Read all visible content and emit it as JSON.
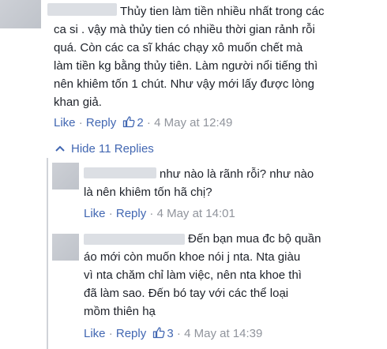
{
  "comment1": {
    "text_lines": [
      "Thủy tien làm tiền nhiều nhất trong các",
      "ca si . vậy mà thủy tien có nhiều thời gian rảnh rỗi",
      "quá. Còn các ca sĩ khác chạy xô muốn chết mà",
      "làm tiền kg bằng thủy tiên. Làm người nổi tiếng thì",
      "nên khiêm tốn 1 chút. Như vậy mới lấy được lòng",
      "khan giả."
    ],
    "like_label": "Like",
    "reply_label": "Reply",
    "like_count": "2",
    "timestamp": "4 May at 12:49"
  },
  "hide_replies_label": "Hide 11 Replies",
  "reply1": {
    "text_lines": [
      "như nào là rãnh rỗi? như nào",
      "là nên khiêm tốn hã chị?"
    ],
    "like_label": "Like",
    "reply_label": "Reply",
    "timestamp": "4 May at 14:01"
  },
  "reply2": {
    "text_lines": [
      "Đến bạn mua đc bộ quần",
      "áo mới còn muốn khoe nói j nta. Nta giàu",
      "vì nta chăm chỉ làm việc, nên nta khoe thì",
      "đã làm sao. Đến bó tay với các thể loại",
      "mồm thiên hạ"
    ],
    "like_label": "Like",
    "reply_label": "Reply",
    "like_count": "3",
    "timestamp": "4 May at 14:39"
  },
  "separator": "·",
  "colors": {
    "link": "#4267b2",
    "meta": "#90949c",
    "text": "#1d2129"
  }
}
